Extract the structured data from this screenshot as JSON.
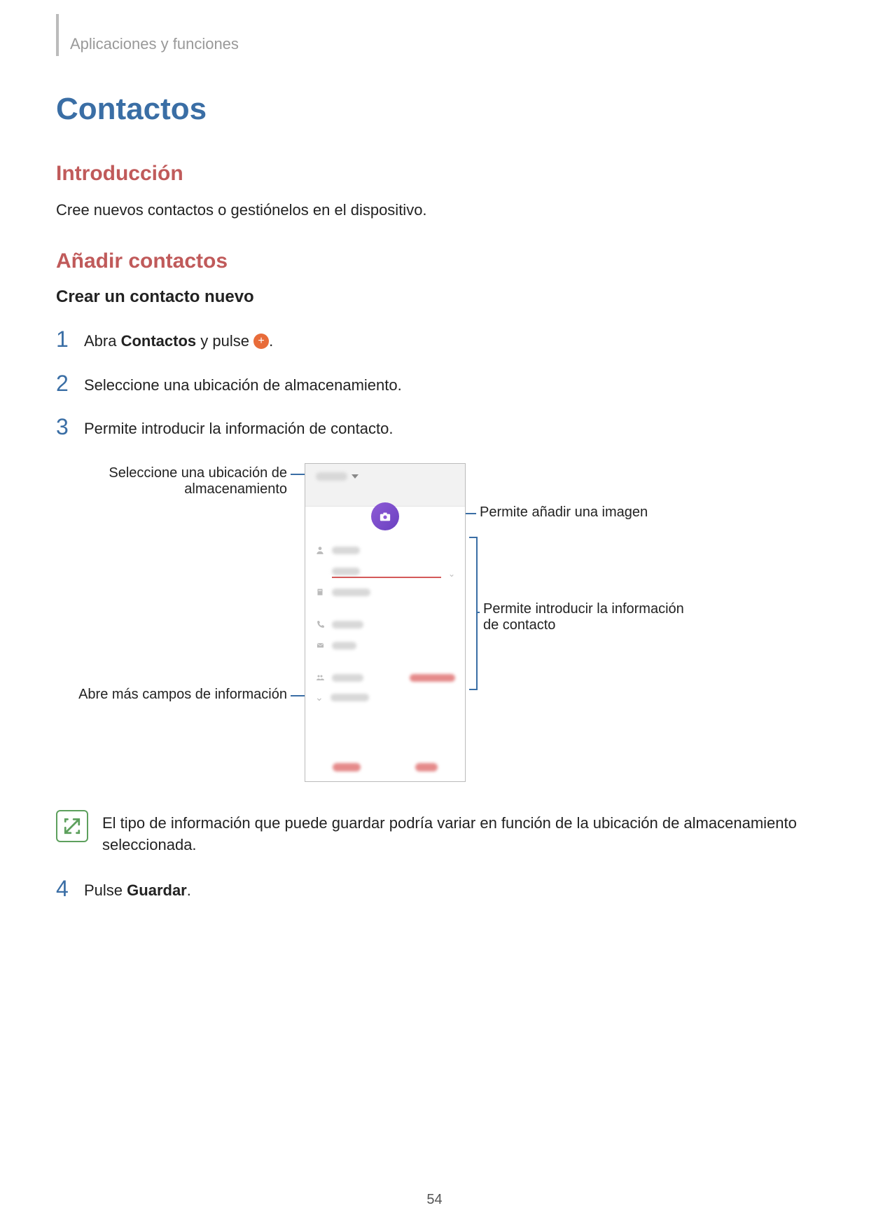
{
  "breadcrumb": "Aplicaciones y funciones",
  "title": "Contactos",
  "intro": {
    "heading": "Introducción",
    "body": "Cree nuevos contactos o gestiónelos en el dispositivo."
  },
  "add": {
    "heading": "Añadir contactos",
    "sub": "Crear un contacto nuevo"
  },
  "steps": {
    "s1_a": "Abra ",
    "s1_b": "Contactos",
    "s1_c": " y pulse ",
    "s1_d": ".",
    "s2": "Seleccione una ubicación de almacenamiento.",
    "s3": "Permite introducir la información de contacto.",
    "s4_a": "Pulse ",
    "s4_b": "Guardar",
    "s4_c": "."
  },
  "nums": {
    "n1": "1",
    "n2": "2",
    "n3": "3",
    "n4": "4"
  },
  "callouts": {
    "storage_l1": "Seleccione una ubicación de",
    "storage_l2": "almacenamiento",
    "more": "Abre más campos de información",
    "image": "Permite añadir una imagen",
    "info_l1": "Permite introducir la información",
    "info_l2": "de contacto"
  },
  "note": "El tipo de información que puede guardar podría variar en función de la ubicación de almacenamiento seleccionada.",
  "page_number": "54"
}
